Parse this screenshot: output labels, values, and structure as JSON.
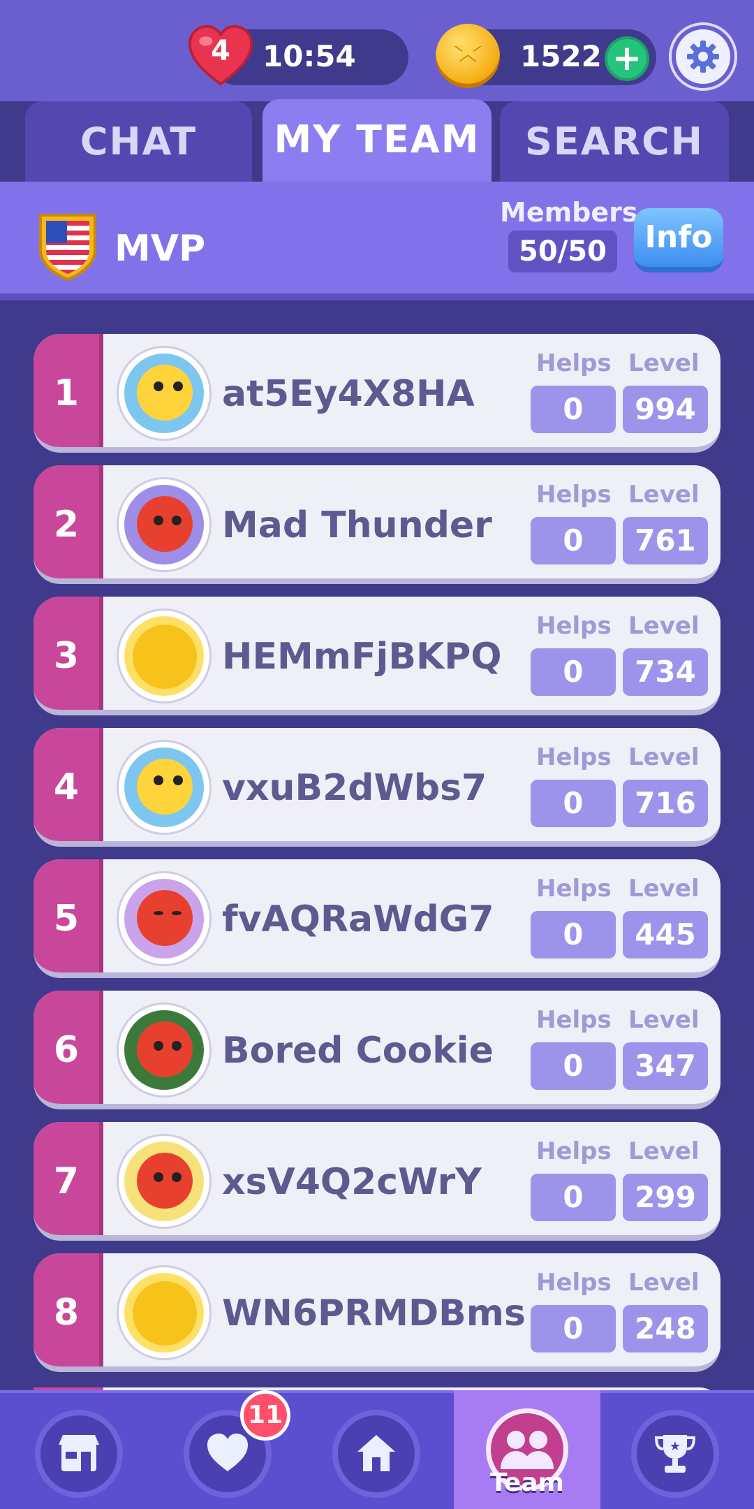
{
  "status": {
    "lives": "4",
    "timer": "10:54",
    "coins": "1522",
    "plus_label": "+"
  },
  "tabs": [
    {
      "label": "CHAT"
    },
    {
      "label": "MY TEAM"
    },
    {
      "label": "SEARCH"
    }
  ],
  "team": {
    "name": "MVP",
    "members_label": "Members",
    "members_count": "50/50",
    "info_label": "Info"
  },
  "members": [
    {
      "rank": "1",
      "name": "at5Ey4X8HA",
      "helps_label": "Helps",
      "level_label": "Level",
      "helps": "0",
      "level": "994",
      "avatar": "yellow-chick-icon"
    },
    {
      "rank": "2",
      "name": "Mad Thunder",
      "helps_label": "Helps",
      "level_label": "Level",
      "helps": "0",
      "level": "761",
      "avatar": "red-cat-icon"
    },
    {
      "rank": "3",
      "name": "HEMmFjBKPQ",
      "helps_label": "Helps",
      "level_label": "Level",
      "helps": "0",
      "level": "734",
      "avatar": "sleepy-yellow-face-icon"
    },
    {
      "rank": "4",
      "name": "vxuB2dWbs7",
      "helps_label": "Helps",
      "level_label": "Level",
      "helps": "0",
      "level": "716",
      "avatar": "yellow-chick-icon"
    },
    {
      "rank": "5",
      "name": "fvAQRaWdG7",
      "helps_label": "Helps",
      "level_label": "Level",
      "helps": "0",
      "level": "445",
      "avatar": "red-cat-icon"
    },
    {
      "rank": "6",
      "name": "Bored Cookie",
      "helps_label": "Helps",
      "level_label": "Level",
      "helps": "0",
      "level": "347",
      "avatar": "red-cat-melon-icon"
    },
    {
      "rank": "7",
      "name": "xsV4Q2cWrY",
      "helps_label": "Helps",
      "level_label": "Level",
      "helps": "0",
      "level": "299",
      "avatar": "red-cat-icon"
    },
    {
      "rank": "8",
      "name": "WN6PRMDBms",
      "helps_label": "Helps",
      "level_label": "Level",
      "helps": "0",
      "level": "248",
      "avatar": "sleepy-yellow-face-icon"
    }
  ],
  "bottom_nav": {
    "shop_icon": "shop-icon",
    "lives_icon": "heart-icon",
    "lives_badge": "11",
    "home_icon": "home-icon",
    "team_label": "Team",
    "leaderboard_icon": "trophy-icon"
  },
  "colors": {
    "background": "#3f3a8c",
    "header": "#8172ea",
    "rank_tab": "#c8479a",
    "row": "#efeff8",
    "stat_box": "#9c93ea",
    "info_button": "#3c8ef0"
  }
}
